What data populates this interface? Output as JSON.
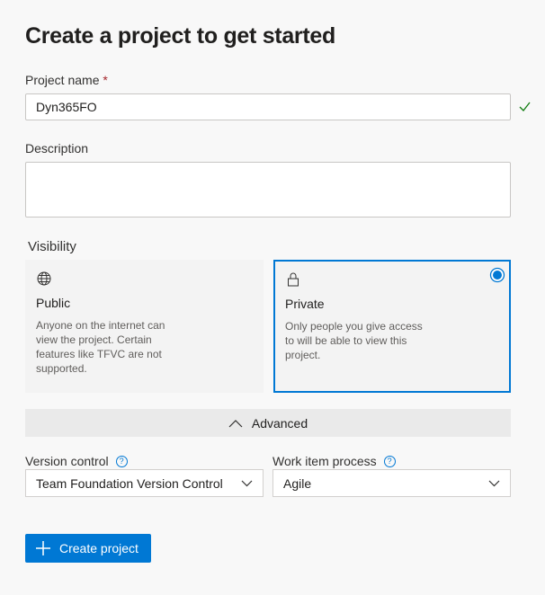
{
  "title": "Create a project to get started",
  "project_name": {
    "label": "Project name",
    "required_marker": "*",
    "value": "Dyn365FO",
    "valid_icon": "checkmark-icon"
  },
  "description": {
    "label": "Description",
    "value": ""
  },
  "visibility": {
    "label": "Visibility",
    "selected": "Private",
    "options": [
      {
        "icon": "globe-icon",
        "title": "Public",
        "description": "Anyone on the internet can view the project. Certain features like TFVC are not supported."
      },
      {
        "icon": "lock-icon",
        "title": "Private",
        "description": "Only people you give access to will be able to view this project."
      }
    ]
  },
  "advanced": {
    "label": "Advanced",
    "expanded": true
  },
  "version_control": {
    "label": "Version control",
    "value": "Team Foundation Version Control"
  },
  "work_item_process": {
    "label": "Work item process",
    "value": "Agile"
  },
  "create_button": {
    "label": "Create project"
  },
  "colors": {
    "accent": "#0078d4",
    "valid": "#107c10"
  }
}
